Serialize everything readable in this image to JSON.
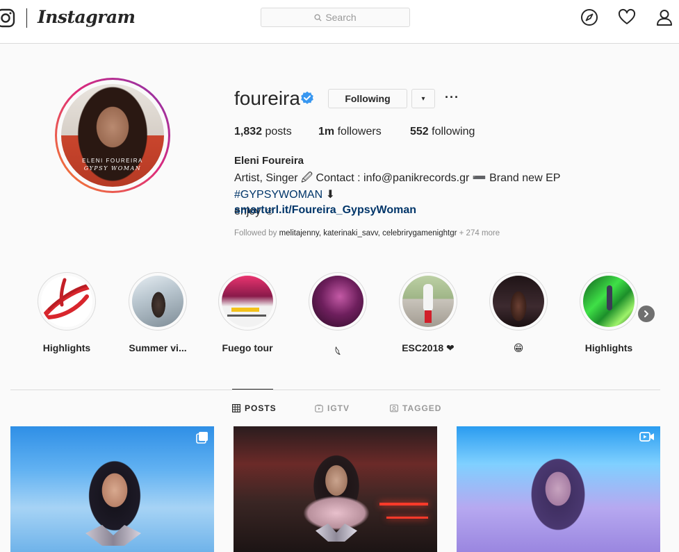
{
  "nav": {
    "wordmark": "Instagram",
    "search_placeholder": "Search",
    "icons": [
      "instagram-glyph-icon",
      "search-icon",
      "compass-icon",
      "heart-icon",
      "user-icon"
    ]
  },
  "profile": {
    "username": "foureira",
    "verified": true,
    "following_label": "Following",
    "dropdown_glyph": "▾",
    "more_glyph": "···",
    "avatar_caption_1": "ELENI FOUREIRA",
    "avatar_caption_2": "GYPSY WOMAN",
    "stats": {
      "posts_value": "1,832",
      "posts_label": " posts",
      "followers_value": "1m",
      "followers_label": " followers",
      "following_value": "552",
      "following_label": " following"
    },
    "full_name": "Eleni Foureira",
    "bio_line1_a": "Artist, Singer 🖉 Contact : info@panikrecords.gr ➖ Brand new EP ",
    "bio_hashtag": "#GYPSYWOMAN",
    "bio_line1_b": " ⬇",
    "bio_line2": "enjoy ☺",
    "link": "smarturl.it/Foureira_GypsyWoman",
    "followed_by_prefix": "Followed by ",
    "followed_by_names": "melitajenny, katerinaki_savv, celebrirygamenightgr",
    "followed_by_more": " + 274 more"
  },
  "highlights": [
    {
      "label": "Highlights"
    },
    {
      "label": "Summer vi..."
    },
    {
      "label": "Fuego tour"
    },
    {
      "label": "𓆩"
    },
    {
      "label": "ESC2018 ❤"
    },
    {
      "label": "😁"
    },
    {
      "label": "Highlights"
    }
  ],
  "tabs": [
    {
      "label": "POSTS",
      "active": true,
      "icon": "grid-icon"
    },
    {
      "label": "IGTV",
      "active": false,
      "icon": "igtv-icon"
    },
    {
      "label": "TAGGED",
      "active": false,
      "icon": "tag-icon"
    }
  ],
  "colors": {
    "link": "#003569",
    "verified": "#3897f0",
    "ring_start": "#f58529",
    "ring_end": "#8134af",
    "border": "#dbdbdb",
    "muted": "#8e8e8e"
  }
}
